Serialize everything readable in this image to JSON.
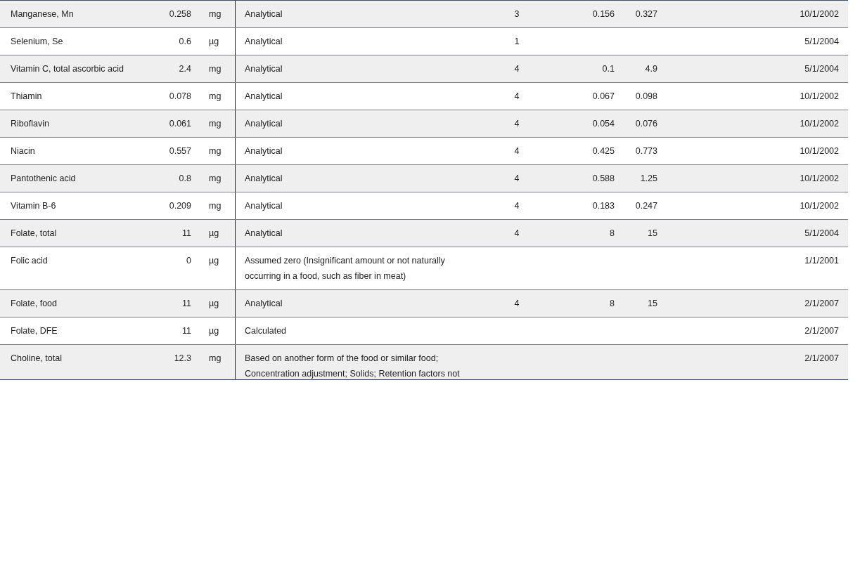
{
  "table": {
    "rows": [
      {
        "nutrient": "Manganese, Mn",
        "value": "0.258",
        "unit": "mg",
        "method": [
          "Analytical"
        ],
        "count": "3",
        "min": "0.156",
        "max": "0.327",
        "date": "10/1/2002"
      },
      {
        "nutrient": "Selenium, Se",
        "value": "0.6",
        "unit": "µg",
        "method": [
          "Analytical"
        ],
        "count": "1",
        "date": "5/1/2004"
      },
      {
        "nutrient": "Vitamin C, total ascorbic acid",
        "value": "2.4",
        "unit": "mg",
        "method": [
          "Analytical"
        ],
        "count": "4",
        "min": "0.1",
        "max": "4.9",
        "date": "5/1/2004"
      },
      {
        "nutrient": "Thiamin",
        "value": "0.078",
        "unit": "mg",
        "method": [
          "Analytical"
        ],
        "count": "4",
        "min": "0.067",
        "max": "0.098",
        "date": "10/1/2002"
      },
      {
        "nutrient": "Riboflavin",
        "value": "0.061",
        "unit": "mg",
        "method": [
          "Analytical"
        ],
        "count": "4",
        "min": "0.054",
        "max": "0.076",
        "date": "10/1/2002"
      },
      {
        "nutrient": "Niacin",
        "value": "0.557",
        "unit": "mg",
        "method": [
          "Analytical"
        ],
        "count": "4",
        "min": "0.425",
        "max": "0.773",
        "date": "10/1/2002"
      },
      {
        "nutrient": "Pantothenic acid",
        "value": "0.8",
        "unit": "mg",
        "method": [
          "Analytical"
        ],
        "count": "4",
        "min": "0.588",
        "max": "1.25",
        "date": "10/1/2002"
      },
      {
        "nutrient": "Vitamin B-6",
        "value": "0.209",
        "unit": "mg",
        "method": [
          "Analytical"
        ],
        "count": "4",
        "min": "0.183",
        "max": "0.247",
        "date": "10/1/2002"
      },
      {
        "nutrient": "Folate, total",
        "value": "11",
        "unit": "µg",
        "method": [
          "Analytical"
        ],
        "count": "4",
        "min": "8",
        "max": "15",
        "date": "5/1/2004"
      },
      {
        "nutrient": "Folic acid",
        "value": "0",
        "unit": "µg",
        "method": [
          "Assumed zero (Insignificant amount or not naturally",
          "occurring in a food, such as fiber in meat)"
        ],
        "date": "1/1/2001"
      },
      {
        "nutrient": "Folate, food",
        "value": "11",
        "unit": "µg",
        "method": [
          "Analytical"
        ],
        "count": "4",
        "min": "8",
        "max": "15",
        "date": "2/1/2007"
      },
      {
        "nutrient": "Folate, DFE",
        "value": "11",
        "unit": "µg",
        "method": [
          "Calculated"
        ],
        "date": "2/1/2007"
      },
      {
        "nutrient": "Choline, total",
        "value": "12.3",
        "unit": "mg",
        "method": [
          "Based on another form of the food or similar food;",
          "Concentration adjustment; Solids; Retention factors not"
        ],
        "date": "2/1/2007"
      }
    ]
  }
}
